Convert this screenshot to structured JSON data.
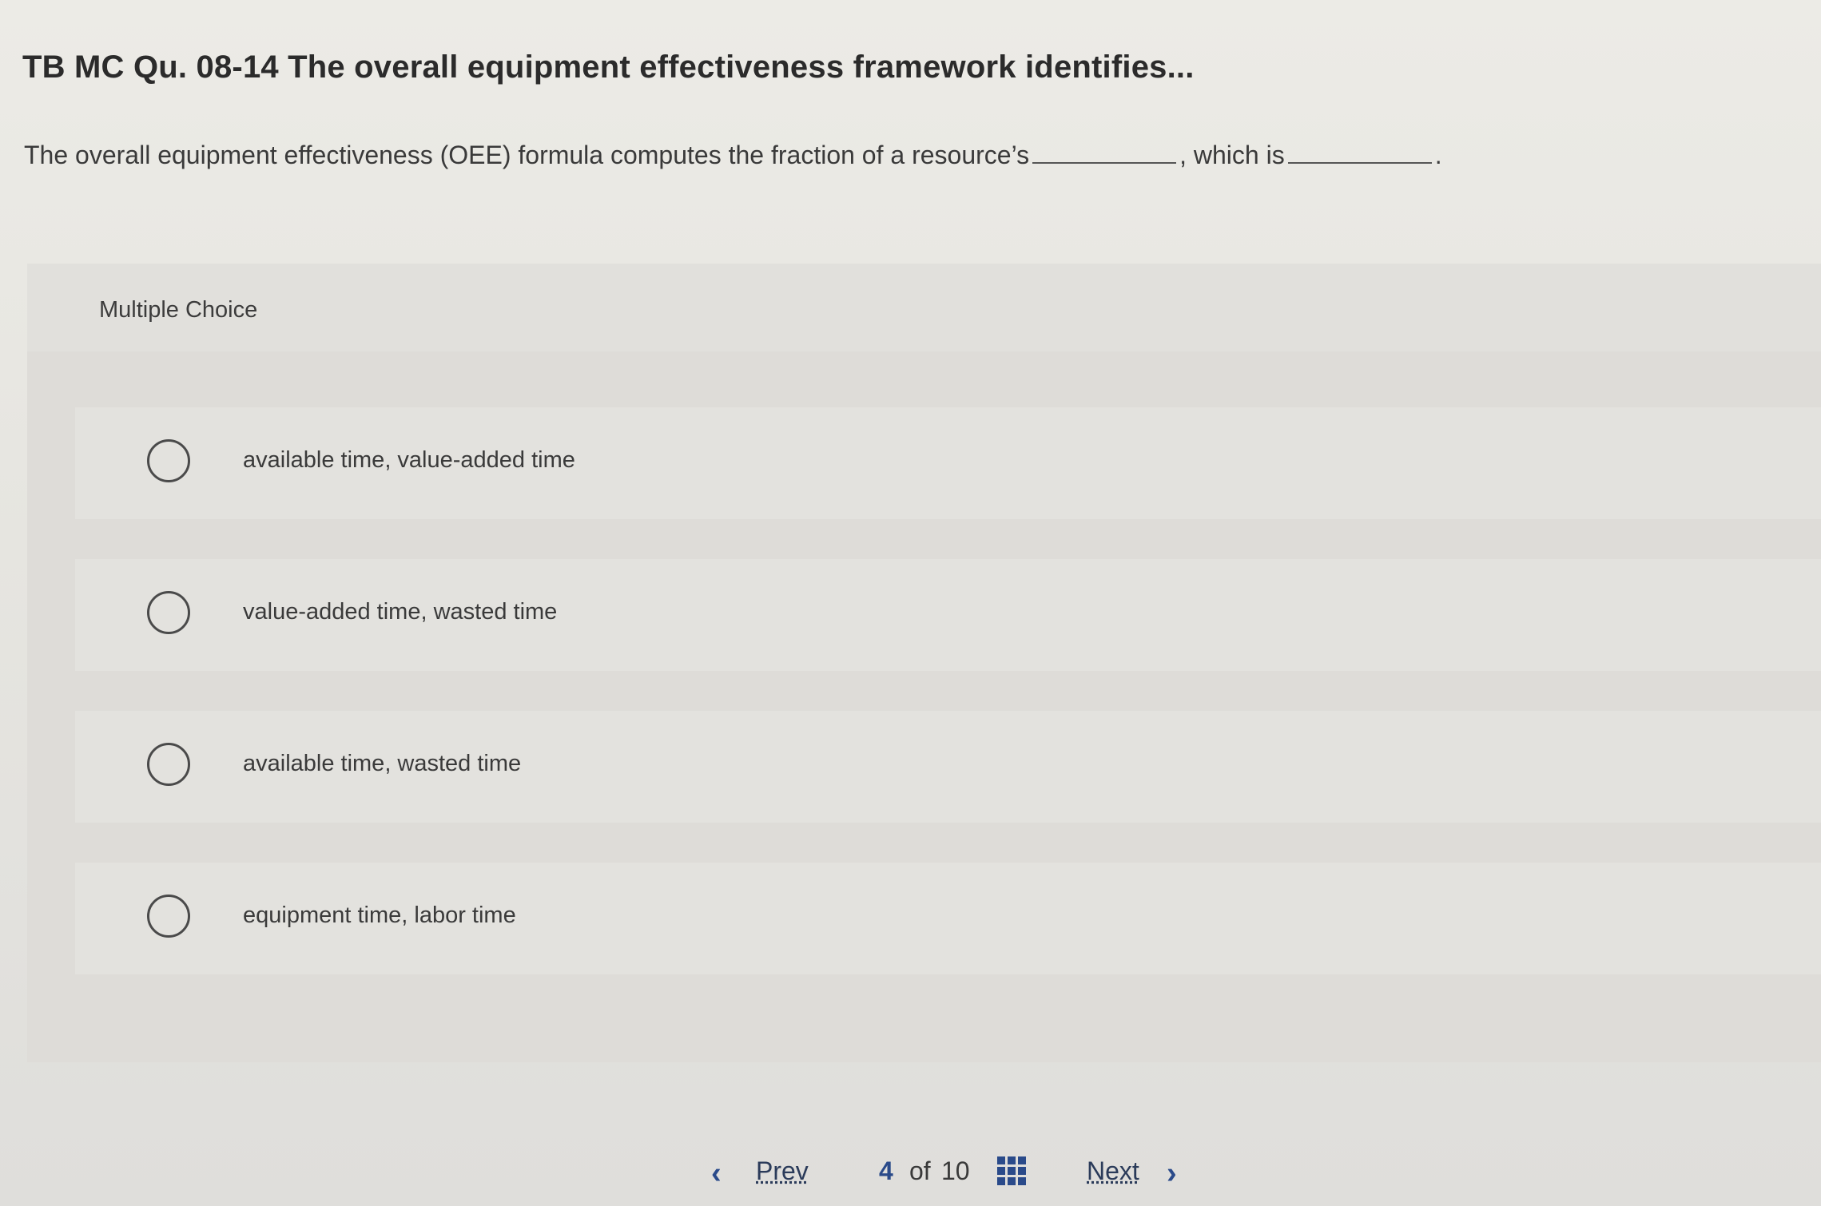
{
  "header": {
    "title": "TB MC Qu. 08-14 The overall equipment effectiveness framework identifies..."
  },
  "question": {
    "part1": "The overall equipment effectiveness (OEE) formula computes the fraction of a resource’s",
    "part2": ", which is",
    "part3": "."
  },
  "multiple_choice": {
    "label": "Multiple Choice",
    "options": [
      "available time, value-added time",
      "value-added time, wasted time",
      "available time, wasted time",
      "equipment time, labor time"
    ]
  },
  "navigation": {
    "prev_label": "Prev",
    "prev_icon": "chevron-left-icon",
    "current_page": "4",
    "of_label": "of",
    "total_pages": "10",
    "grid_icon": "grid-icon",
    "next_label": "Next",
    "next_icon": "chevron-right-icon",
    "accent_color": "#2a4a8a"
  }
}
